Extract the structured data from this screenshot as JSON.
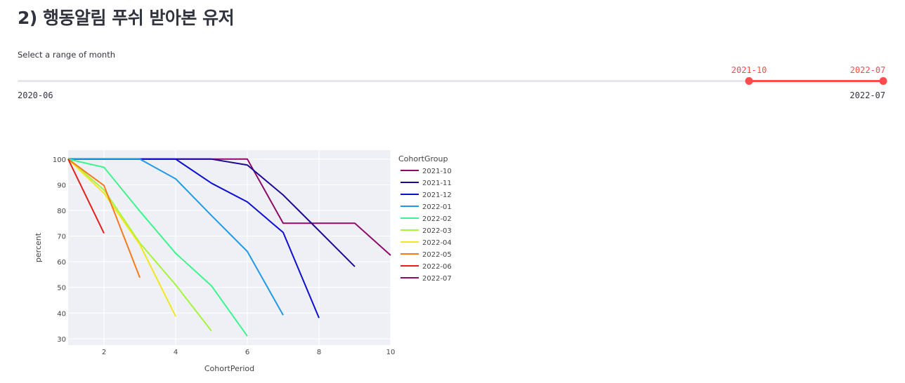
{
  "header": {
    "title": "2) 행동알림 푸쉬 받아본 유저"
  },
  "slider": {
    "label": "Select a range of month",
    "min_label": "2020-06",
    "max_label": "2022-07",
    "selected_start": "2021-10",
    "selected_end": "2022-07",
    "start_fraction": 0.845,
    "end_fraction": 1.0,
    "accent_color": "#ff4b4b"
  },
  "chart_data": {
    "type": "line",
    "title": "",
    "xlabel": "CohortPeriod",
    "ylabel": "percent",
    "xlim": [
      1,
      10
    ],
    "ylim": [
      27.5,
      103.5
    ],
    "xticks": [
      2,
      4,
      6,
      8,
      10
    ],
    "yticks": [
      30,
      40,
      50,
      60,
      70,
      80,
      90,
      100
    ],
    "grid": true,
    "legend_title": "CohortGroup",
    "legend_position": "right",
    "series": [
      {
        "name": "2021-10",
        "color": "#8b0a6a",
        "x": [
          1,
          2,
          3,
          4,
          5,
          6,
          7,
          8,
          9,
          10
        ],
        "y": [
          100,
          100,
          100,
          100,
          100,
          100,
          75,
          75,
          75,
          62.5
        ]
      },
      {
        "name": "2021-11",
        "color": "#1a0a96",
        "x": [
          1,
          2,
          3,
          4,
          5,
          6,
          7,
          8,
          9
        ],
        "y": [
          100,
          100,
          100,
          100,
          100,
          97.7,
          86.0,
          72.1,
          58.1
        ]
      },
      {
        "name": "2021-12",
        "color": "#0c0ed6",
        "x": [
          1,
          2,
          3,
          4,
          5,
          6,
          7,
          8
        ],
        "y": [
          100,
          100,
          100,
          100,
          90.6,
          83.3,
          71.4,
          38.1
        ]
      },
      {
        "name": "2022-01",
        "color": "#1f9ae6",
        "x": [
          1,
          2,
          3,
          4,
          5,
          6,
          7
        ],
        "y": [
          100,
          100,
          100,
          92.3,
          78.0,
          64.0,
          39.2
        ]
      },
      {
        "name": "2022-02",
        "color": "#3cf58c",
        "x": [
          1,
          2,
          3,
          4,
          5,
          6
        ],
        "y": [
          100,
          96.8,
          79.7,
          63.3,
          50.6,
          31.0
        ]
      },
      {
        "name": "2022-03",
        "color": "#a4f53c",
        "x": [
          1,
          2,
          3,
          4,
          5
        ],
        "y": [
          100,
          88.0,
          67.3,
          51.0,
          33.0
        ]
      },
      {
        "name": "2022-04",
        "color": "#f2e61e",
        "x": [
          1,
          2,
          3,
          4
        ],
        "y": [
          100,
          86.7,
          66.7,
          38.7
        ]
      },
      {
        "name": "2022-05",
        "color": "#f57a1e",
        "x": [
          1,
          2,
          3
        ],
        "y": [
          100,
          89.7,
          53.8
        ]
      },
      {
        "name": "2022-06",
        "color": "#e61e1e",
        "x": [
          1,
          2
        ],
        "y": [
          100,
          71.1
        ]
      },
      {
        "name": "2022-07",
        "color": "#8b0a6a",
        "x": [
          1
        ],
        "y": [
          100
        ]
      }
    ]
  }
}
